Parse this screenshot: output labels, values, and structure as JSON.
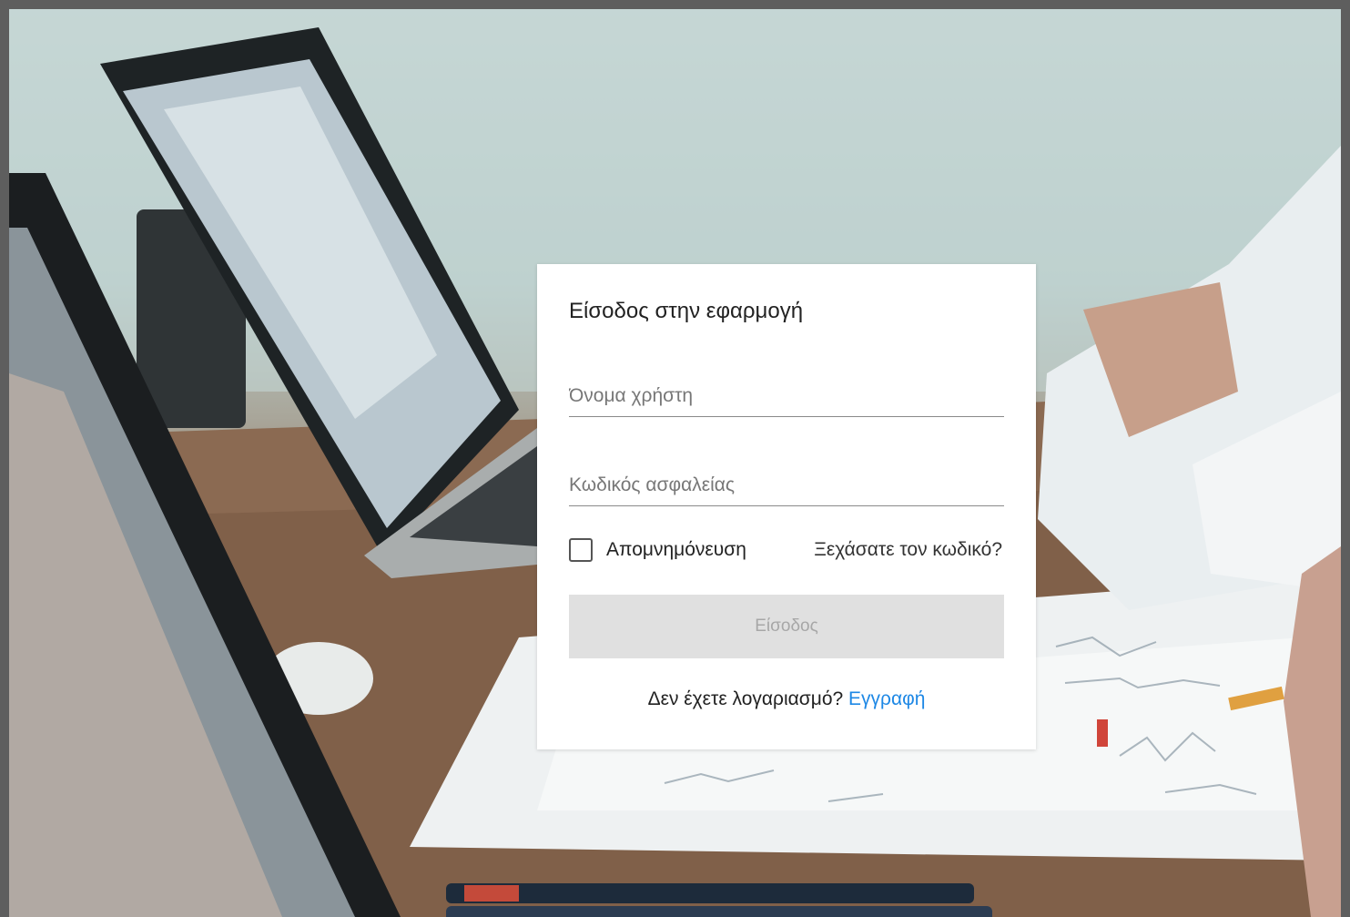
{
  "login": {
    "title": "Είσοδος στην εφαρμογή",
    "username_placeholder": "Όνομα χρήστη",
    "username_value": "",
    "password_placeholder": "Κωδικός ασφαλείας",
    "password_value": "",
    "remember_label": "Απομνημόνευση",
    "remember_checked": false,
    "forgot_label": "Ξεχάσατε τον κωδικό?",
    "submit_label": "Είσοδος",
    "no_account_text": "Δεν έχετε λογαριασμό?",
    "signup_label": "Εγγραφή"
  },
  "colors": {
    "link": "#1e88e5",
    "button_disabled_bg": "#e0e0e0",
    "button_disabled_text": "#a7a7a7"
  }
}
